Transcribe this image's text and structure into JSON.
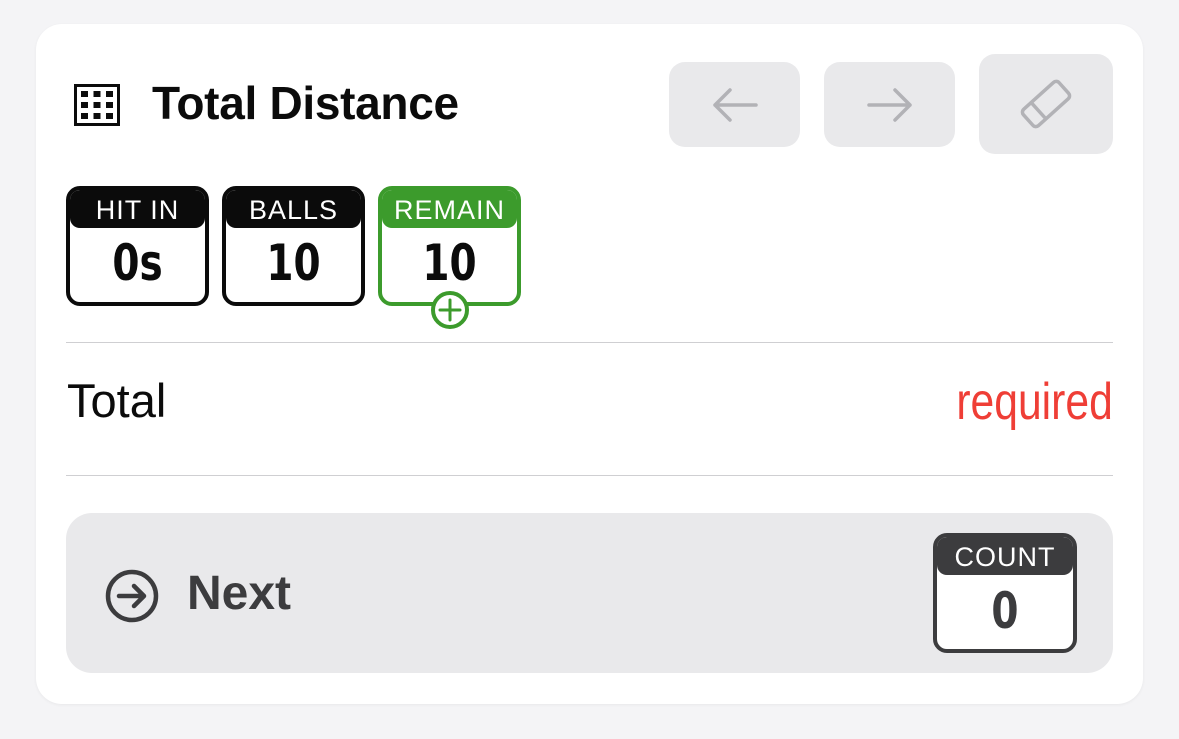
{
  "header": {
    "icon": "grid-icon",
    "title": "Total Distance",
    "back_icon": "arrow-left-icon",
    "forward_icon": "arrow-right-icon",
    "erase_icon": "eraser-icon"
  },
  "stats": {
    "hit_in": {
      "label": "HIT IN",
      "value": "0s"
    },
    "balls": {
      "label": "BALLS",
      "value": "10"
    },
    "remain": {
      "label": "REMAIN",
      "value": "10",
      "add_icon": "plus-circle-icon"
    }
  },
  "total_row": {
    "label": "Total",
    "status": "required"
  },
  "next_bar": {
    "icon": "arrow-right-circle-icon",
    "label": "Next",
    "count": {
      "label": "COUNT",
      "value": "0"
    }
  },
  "colors": {
    "accent_green": "#3c9b2c",
    "required_red": "#ef3e36",
    "button_bg": "#e9e9eb",
    "text_dark": "#0b0b0b",
    "text_muted": "#3c3c3e"
  }
}
